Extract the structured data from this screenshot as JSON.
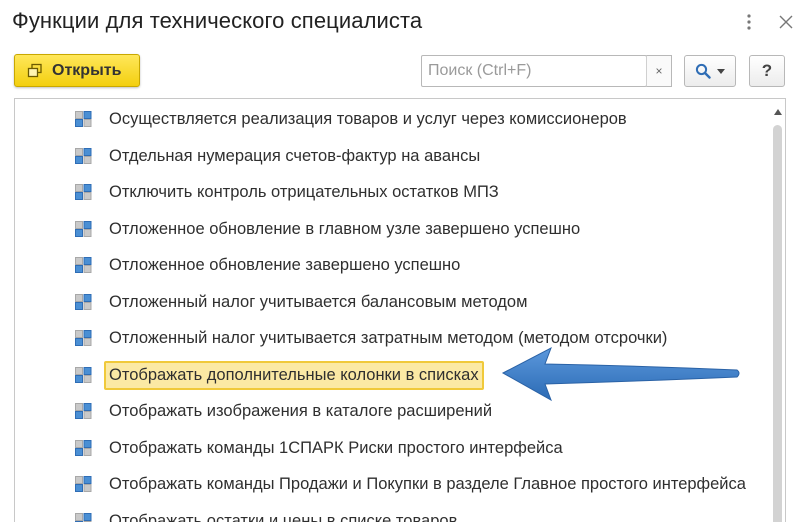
{
  "window": {
    "title": "Функции для технического специалиста"
  },
  "toolbar": {
    "open_label": "Открыть",
    "search_placeholder": "Поиск (Ctrl+F)",
    "clear_label": "×",
    "help_label": "?"
  },
  "list": {
    "items": [
      {
        "label": "Осуществляется реализация товаров и услуг через комиссионеров"
      },
      {
        "label": "Отдельная нумерация счетов-фактур на авансы"
      },
      {
        "label": "Отключить контроль отрицательных остатков МПЗ"
      },
      {
        "label": "Отложенное обновление в главном узле завершено успешно"
      },
      {
        "label": "Отложенное обновление завершено успешно"
      },
      {
        "label": "Отложенный налог учитывается балансовым методом"
      },
      {
        "label": "Отложенный налог учитывается затратным методом (методом отсрочки)"
      },
      {
        "label": "Отображать дополнительные колонки в списках",
        "selected": true
      },
      {
        "label": "Отображать изображения в каталоге расширений"
      },
      {
        "label": "Отображать команды 1СПАРК Риски простого интерфейса"
      },
      {
        "label": "Отображать команды Продажи и Покупки в разделе Главное простого интерфейса"
      },
      {
        "label": "Отображать остатки и цены в списке товаров"
      }
    ]
  },
  "colors": {
    "accent_yellow": "#f3cf0f",
    "selection_bg": "#fbe9a4",
    "selection_border": "#f0c93a",
    "arrow_blue": "#3d7fc9",
    "icon_blue": "#4a8fd4",
    "icon_gray": "#b5b5b5"
  },
  "icons": {
    "window_more": "vertical-dots-icon",
    "window_close": "close-icon",
    "open": "open-window-icon",
    "search": "magnifier-icon",
    "search_dropdown": "chevron-down-icon",
    "row": "functional-option-icon",
    "annotation": "pointer-arrow"
  }
}
